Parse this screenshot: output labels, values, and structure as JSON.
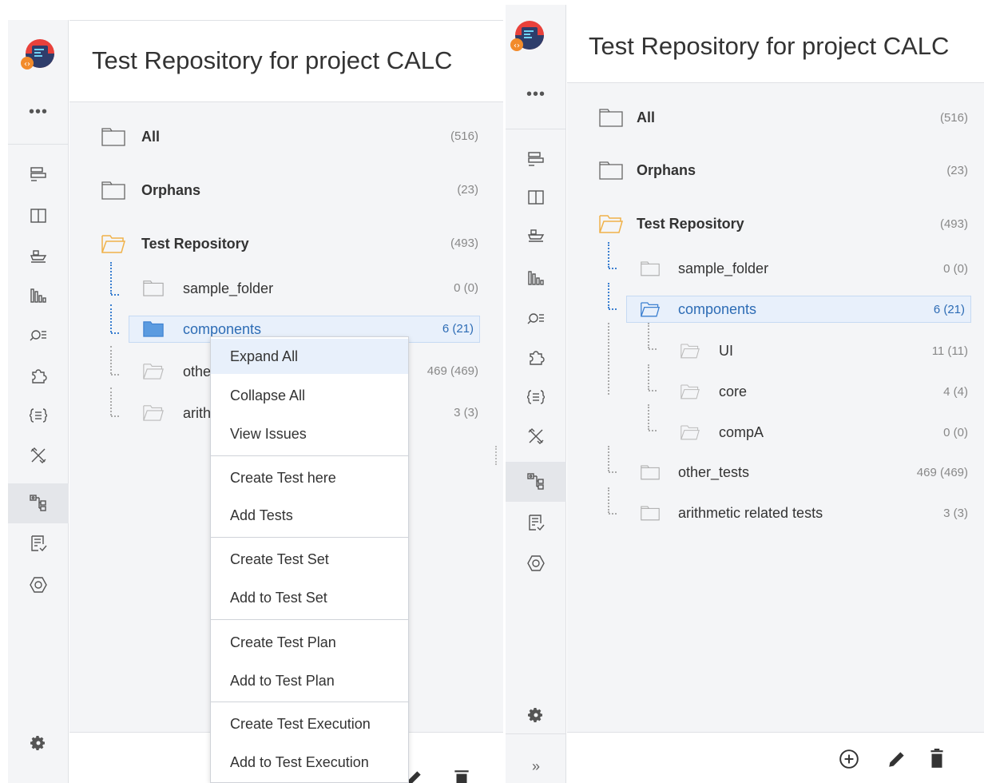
{
  "left": {
    "title": "Test Repository for project CALC",
    "tree": [
      {
        "label": "All",
        "count": "(516)"
      },
      {
        "label": "Orphans",
        "count": "(23)"
      },
      {
        "label": "Test Repository",
        "count": "(493)"
      },
      {
        "label": "sample_folder",
        "count": "0 (0)"
      },
      {
        "label": "components",
        "count": "6 (21)"
      },
      {
        "label": "othe",
        "count": "469 (469)"
      },
      {
        "label": "arith",
        "count": "3 (3)"
      }
    ],
    "context_menu": [
      "Expand All",
      "Collapse All",
      "View Issues",
      "Create Test here",
      "Add Tests",
      "Create Test Set",
      "Add to Test Set",
      "Create Test Plan",
      "Add to Test Plan",
      "Create Test Execution",
      "Add to Test Execution"
    ]
  },
  "right": {
    "title": "Test Repository for project CALC",
    "tree": [
      {
        "label": "All",
        "count": "(516)"
      },
      {
        "label": "Orphans",
        "count": "(23)"
      },
      {
        "label": "Test Repository",
        "count": "(493)"
      },
      {
        "label": "sample_folder",
        "count": "0 (0)"
      },
      {
        "label": "components",
        "count": "6 (21)"
      },
      {
        "label": "UI",
        "count": "11 (11)"
      },
      {
        "label": "core",
        "count": "4 (4)"
      },
      {
        "label": "compA",
        "count": "0 (0)"
      },
      {
        "label": "other_tests",
        "count": "469 (469)"
      },
      {
        "label": "arithmetic related tests",
        "count": "3 (3)"
      }
    ],
    "more_label": "•••",
    "collapse_label": "»"
  },
  "icons": {
    "more": "more-icon",
    "settings": "gear-icon",
    "add": "add-circle-icon",
    "edit": "pencil-icon",
    "delete": "trash-icon"
  },
  "colors": {
    "selected_text": "#2d6cb5",
    "selected_bg": "#e8f0fb",
    "open_folder": "#f0b24a",
    "selected_folder": "#3b7fd0"
  }
}
